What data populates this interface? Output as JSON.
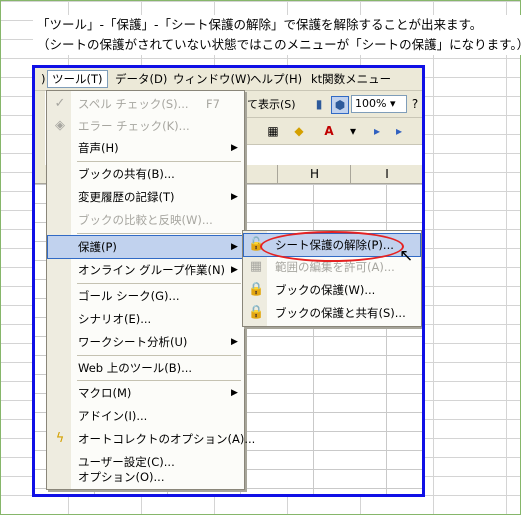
{
  "caption": {
    "line1": "「ツール」-「保護」-「シート保護の解除」で保護を解除することが出来ます。",
    "line2": "（シートの保護がされていない状態ではこのメニューが「シートの保護」になります。）"
  },
  "menubar": {
    "tools": "ツール(T)",
    "data": "データ(D)",
    "window": "ウィンドウ(W)",
    "help": "ヘルプ(H)",
    "kt": "kt関数メニュー"
  },
  "toolbar": {
    "show_label": "て表示(S)",
    "zoom": "100%"
  },
  "columns": [
    "H",
    "I"
  ],
  "tools_menu": {
    "items": [
      {
        "label": "スペル チェック(S)...",
        "shortcut": "F7",
        "disabled": true,
        "icon": "spellcheck-icon"
      },
      {
        "label": "エラー チェック(K)...",
        "disabled": true,
        "icon": "error-check-icon"
      },
      {
        "label": "音声(H)",
        "submenu": true
      },
      {
        "label": "ブックの共有(B)..."
      },
      {
        "label": "変更履歴の記録(T)",
        "submenu": true
      },
      {
        "label": "ブックの比較と反映(W)...",
        "disabled": true
      },
      {
        "label": "保護(P)",
        "submenu": true,
        "highlighted": true
      },
      {
        "label": "オンライン グループ作業(N)",
        "submenu": true
      },
      {
        "label": "ゴール シーク(G)..."
      },
      {
        "label": "シナリオ(E)..."
      },
      {
        "label": "ワークシート分析(U)",
        "submenu": true
      },
      {
        "label": "Web 上のツール(B)..."
      },
      {
        "label": "マクロ(M)",
        "submenu": true
      },
      {
        "label": "アドイン(I)..."
      },
      {
        "label": "オートコレクトのオプション(A)...",
        "icon": "autocorrect-icon"
      },
      {
        "label": "ユーザー設定(C)..."
      },
      {
        "label": "オプション(O)..."
      }
    ]
  },
  "protect_submenu": {
    "items": [
      {
        "label": "シート保護の解除(P)...",
        "icon": "unprotect-sheet-icon",
        "highlighted": true
      },
      {
        "label": "範囲の編集を許可(A)...",
        "disabled": true,
        "icon": "allow-edit-ranges-icon"
      },
      {
        "label": "ブックの保護(W)...",
        "icon": "protect-book-icon"
      },
      {
        "label": "ブックの保護と共有(S)...",
        "icon": "protect-share-book-icon"
      }
    ]
  },
  "colors": {
    "frame": "#1010e6",
    "highlight": "#c1d2ee",
    "annotation": "#e52222"
  }
}
